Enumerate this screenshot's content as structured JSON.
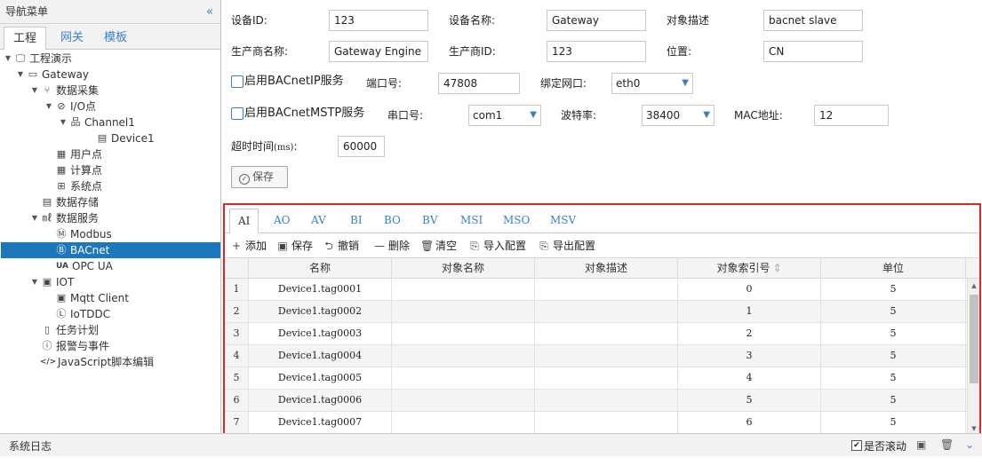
{
  "sidebar": {
    "title": "导航菜单",
    "collapse_icon": "«",
    "tabs": [
      "工程",
      "网关",
      "模板"
    ],
    "tree": [
      {
        "label": "工程演示",
        "toggle": "▼",
        "icon": "monitor-icon",
        "glyph": "🖵",
        "indent": 0
      },
      {
        "label": "Gateway",
        "toggle": "▼",
        "icon": "computer-icon",
        "glyph": "▭",
        "indent": 1
      },
      {
        "label": "数据采集",
        "toggle": "▼",
        "icon": "branch-icon",
        "glyph": "⑂",
        "indent": 2
      },
      {
        "label": "I/O点",
        "toggle": "▼",
        "icon": "tag-icon",
        "glyph": "⊘",
        "indent": 3
      },
      {
        "label": "Channel1",
        "toggle": "▼",
        "icon": "network-icon",
        "glyph": "品",
        "indent": 4
      },
      {
        "label": "Device1",
        "toggle": "",
        "icon": "device-icon",
        "glyph": "▤",
        "indent": 5
      },
      {
        "label": "用户点",
        "toggle": "",
        "icon": "user-point-icon",
        "glyph": "▦",
        "indent": 3
      },
      {
        "label": "计算点",
        "toggle": "",
        "icon": "calculator-icon",
        "glyph": "▦",
        "indent": 3
      },
      {
        "label": "系统点",
        "toggle": "",
        "icon": "grid-icon",
        "glyph": "⊞",
        "indent": 3
      },
      {
        "label": "数据存储",
        "toggle": "",
        "icon": "database-icon",
        "glyph": "▤",
        "indent": 2
      },
      {
        "label": "数据服务",
        "toggle": "▼",
        "icon": "chart-icon",
        "glyph": "㎖",
        "indent": 2
      },
      {
        "label": "Modbus",
        "toggle": "",
        "icon": "modbus-icon",
        "glyph": "Ⓜ",
        "indent": 3
      },
      {
        "label": "BACnet",
        "toggle": "",
        "icon": "bacnet-icon",
        "glyph": "Ⓑ",
        "indent": 3,
        "selected": true
      },
      {
        "label": "OPC UA",
        "toggle": "",
        "icon": "opcua-icon",
        "glyph": "UA",
        "indent": 3
      },
      {
        "label": "IOT",
        "toggle": "▼",
        "icon": "iot-icon",
        "glyph": "▣",
        "indent": 2
      },
      {
        "label": "Mqtt Client",
        "toggle": "",
        "icon": "mqtt-icon",
        "glyph": "▣",
        "indent": 3
      },
      {
        "label": "IoTDDC",
        "toggle": "",
        "icon": "iotddc-icon",
        "glyph": "Ⓛ",
        "indent": 3
      },
      {
        "label": "任务计划",
        "toggle": "",
        "icon": "task-icon",
        "glyph": "▯",
        "indent": 2
      },
      {
        "label": "报警与事件",
        "toggle": "",
        "icon": "alarm-icon",
        "glyph": "ⓘ",
        "indent": 2
      },
      {
        "label": "JavaScript脚本编辑",
        "toggle": "",
        "icon": "code-icon",
        "glyph": "</>",
        "indent": 2
      }
    ]
  },
  "form": {
    "device_id_label": "设备ID:",
    "device_id_value": "123",
    "device_name_label": "设备名称:",
    "device_name_value": "Gateway",
    "object_desc_label": "对象描述",
    "object_desc_value": "bacnet slave",
    "vendor_name_label": "生产商名称:",
    "vendor_name_value": "Gateway Engine",
    "vendor_id_label": "生产商ID:",
    "vendor_id_value": "123",
    "location_label": "位置:",
    "location_value": "CN",
    "bacnet_ip_label": "启用BACnetIP服务",
    "port_label": "端口号:",
    "port_value": "47808",
    "bind_nic_label": "绑定网口:",
    "bind_nic_value": "eth0",
    "bacnet_mstp_label": "启用BACnetMSTP服务",
    "serial_label": "串口号:",
    "serial_value": "com1",
    "baud_label": "波特率:",
    "baud_value": "38400",
    "mac_label": "MAC地址:",
    "mac_value": "12",
    "timeout_label": "超时时间",
    "timeout_unit": "(ms)",
    "timeout_colon": ":",
    "timeout_value": "60000",
    "save_label": "保存"
  },
  "panel": {
    "tabs": [
      "AI",
      "AO",
      "AV",
      "BI",
      "BO",
      "BV",
      "MSI",
      "MSO",
      "MSV"
    ],
    "active_tab": "AI",
    "tools": [
      {
        "label": "添加",
        "icon": "plus-icon",
        "glyph": "+"
      },
      {
        "label": "保存",
        "icon": "save-icon",
        "glyph": "▣"
      },
      {
        "label": "撤销",
        "icon": "undo-icon",
        "glyph": "⮌"
      },
      {
        "label": "删除",
        "icon": "minus-icon",
        "glyph": "—"
      },
      {
        "label": "清空",
        "icon": "trash-icon",
        "glyph": "🗑"
      },
      {
        "label": "导入配置",
        "icon": "import-icon",
        "glyph": "⎘"
      },
      {
        "label": "导出配置",
        "icon": "export-icon",
        "glyph": "⎘"
      }
    ],
    "columns": [
      "名称",
      "对象名称",
      "对象描述",
      "对象索引号",
      "单位"
    ],
    "sort_icon": "⇕",
    "rows": [
      {
        "n": "1",
        "name": "Device1.tag0001",
        "obj_name": "",
        "obj_desc": "",
        "index": "0",
        "unit": "5"
      },
      {
        "n": "2",
        "name": "Device1.tag0002",
        "obj_name": "",
        "obj_desc": "",
        "index": "1",
        "unit": "5"
      },
      {
        "n": "3",
        "name": "Device1.tag0003",
        "obj_name": "",
        "obj_desc": "",
        "index": "2",
        "unit": "5"
      },
      {
        "n": "4",
        "name": "Device1.tag0004",
        "obj_name": "",
        "obj_desc": "",
        "index": "3",
        "unit": "5"
      },
      {
        "n": "5",
        "name": "Device1.tag0005",
        "obj_name": "",
        "obj_desc": "",
        "index": "4",
        "unit": "5"
      },
      {
        "n": "6",
        "name": "Device1.tag0006",
        "obj_name": "",
        "obj_desc": "",
        "index": "5",
        "unit": "5"
      },
      {
        "n": "7",
        "name": "Device1.tag0007",
        "obj_name": "",
        "obj_desc": "",
        "index": "6",
        "unit": "5"
      }
    ]
  },
  "bottom": {
    "title": "系统日志",
    "autoscroll_label": "是否滚动",
    "autoscroll_checked": "✔"
  },
  "colors": {
    "accent": "#1c77bd",
    "link": "#3a7fc4",
    "highlight_border": "#e3252b"
  }
}
